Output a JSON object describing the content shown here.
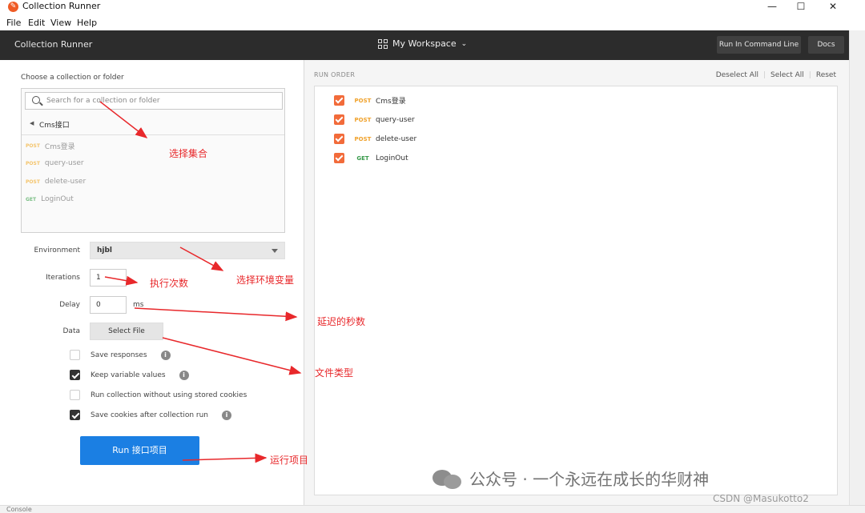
{
  "window": {
    "title": "Collection Runner",
    "minimize": "—",
    "maximize": "☐",
    "close": "✕"
  },
  "menu": [
    "File",
    "Edit",
    "View",
    "Help"
  ],
  "header": {
    "title": "Collection Runner",
    "workspace": "My Workspace",
    "run_cli": "Run In Command Line",
    "docs": "Docs"
  },
  "left": {
    "choose_label": "Choose a collection or folder",
    "search_placeholder": "Search for a collection or folder",
    "crumb": "Cms接口",
    "requests": [
      {
        "method": "POST",
        "name": "Cms登录"
      },
      {
        "method": "POST",
        "name": "query-user"
      },
      {
        "method": "POST",
        "name": "delete-user"
      },
      {
        "method": "GET",
        "name": "LoginOut"
      }
    ],
    "env_label": "Environment",
    "env_value": "hjbl",
    "iter_label": "Iterations",
    "iter_value": "1",
    "delay_label": "Delay",
    "delay_value": "0",
    "delay_unit": "ms",
    "data_label": "Data",
    "select_file": "Select File",
    "options": [
      {
        "label": "Save responses",
        "checked": false,
        "info": true
      },
      {
        "label": "Keep variable values",
        "checked": true,
        "info": true
      },
      {
        "label": "Run collection without using stored cookies",
        "checked": false,
        "info": false
      },
      {
        "label": "Save cookies after collection run",
        "checked": true,
        "info": true
      }
    ],
    "run_button": "Run 接口项目"
  },
  "right": {
    "run_order": "RUN ORDER",
    "deselect_all": "Deselect All",
    "select_all": "Select All",
    "reset": "Reset",
    "items": [
      {
        "method": "POST",
        "name": "Cms登录"
      },
      {
        "method": "POST",
        "name": "query-user"
      },
      {
        "method": "POST",
        "name": "delete-user"
      },
      {
        "method": "GET",
        "name": "LoginOut"
      }
    ]
  },
  "annotations": {
    "select_collection": "选择集合",
    "iterations": "执行次数",
    "environment": "选择环境变量",
    "delay": "延迟的秒数",
    "file_type": "文件类型",
    "run": "运行项目"
  },
  "bottom": {
    "console": "Console"
  },
  "watermark": "公众号 · 一个永远在成长的华财神",
  "csdn": "CSDN @Masukotto2",
  "colors": {
    "header_bg": "#2c2c2c",
    "accent_orange": "#f26b3a",
    "run_blue": "#1b7fe3",
    "annotation_red": "#e8282b"
  }
}
